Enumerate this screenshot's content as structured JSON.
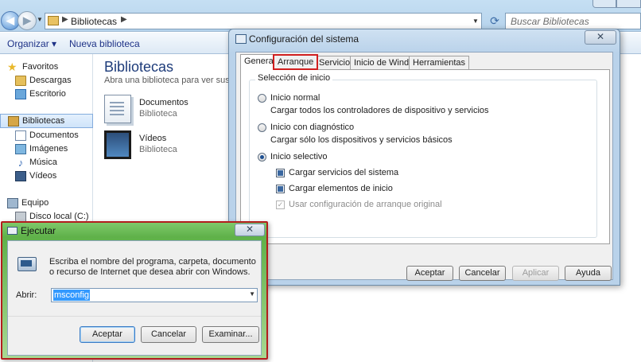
{
  "explorer": {
    "address_crumb": "Bibliotecas",
    "search_placeholder": "Buscar Bibliotecas",
    "toolbar": {
      "organize": "Organizar ▾",
      "new_library": "Nueva biblioteca"
    },
    "nav": {
      "favorites": "Favoritos",
      "downloads": "Descargas",
      "desktop": "Escritorio",
      "libraries": "Bibliotecas",
      "documents": "Documentos",
      "images": "Imágenes",
      "music": "Música",
      "videos": "Vídeos",
      "computer": "Equipo",
      "local_disk": "Disco local (C:)"
    },
    "content": {
      "title": "Bibliotecas",
      "subtitle": "Abra una biblioteca para ver sus arc",
      "items": [
        {
          "name": "Documentos",
          "kind": "Biblioteca"
        },
        {
          "name": "Vídeos",
          "kind": "Biblioteca"
        }
      ]
    }
  },
  "config_dialog": {
    "title": "Configuración del sistema",
    "close_glyph": "✕",
    "tabs": [
      "General",
      "Arranque",
      "Servicios",
      "Inicio de Windows",
      "Herramientas"
    ],
    "group_label": "Selección de inicio",
    "options": {
      "normal": {
        "label": "Inicio normal",
        "desc": "Cargar todos los controladores de dispositivo y servicios"
      },
      "diagnostic": {
        "label": "Inicio con diagnóstico",
        "desc": "Cargar sólo los dispositivos y servicios básicos"
      },
      "selective": {
        "label": "Inicio selectivo"
      }
    },
    "checks": {
      "system_services": "Cargar servicios del sistema",
      "startup_items": "Cargar elementos de inicio",
      "original_boot": "Usar configuración de arranque original"
    },
    "buttons": {
      "ok": "Aceptar",
      "cancel": "Cancelar",
      "apply": "Aplicar",
      "help": "Ayuda"
    }
  },
  "run_dialog": {
    "title": "Ejecutar",
    "close_glyph": "✕",
    "description": "Escriba el nombre del programa, carpeta, documento o recurso de Internet que desea abrir con Windows.",
    "open_label": "Abrir:",
    "input_value": "msconfig",
    "buttons": {
      "ok": "Aceptar",
      "cancel": "Cancelar",
      "browse": "Examinar..."
    }
  }
}
